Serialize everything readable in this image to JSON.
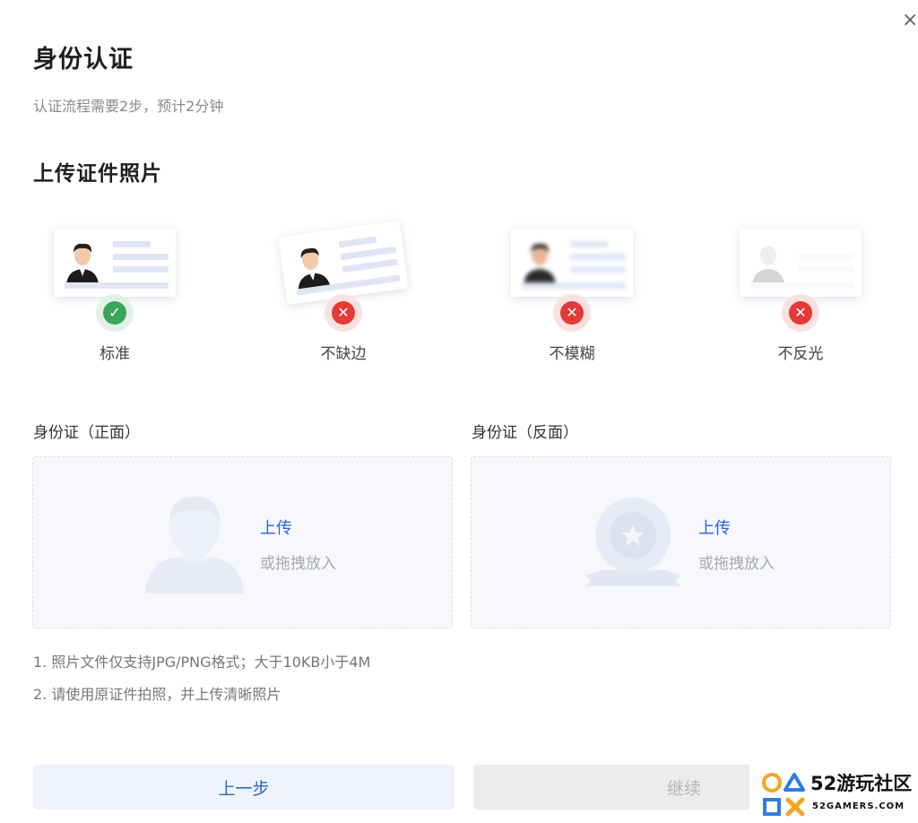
{
  "dialog": {
    "title": "身份认证",
    "subtitle": "认证流程需要2步，预计2分钟",
    "close_icon": "×"
  },
  "photo_section": {
    "title": "上传证件照片",
    "examples": [
      {
        "label": "标准",
        "status": "ok",
        "icon": "check-icon",
        "glyph": "✓"
      },
      {
        "label": "不缺边",
        "status": "bad",
        "icon": "x-icon",
        "glyph": "✕"
      },
      {
        "label": "不模糊",
        "status": "bad",
        "icon": "x-icon",
        "glyph": "✕"
      },
      {
        "label": "不反光",
        "status": "bad",
        "icon": "x-icon",
        "glyph": "✕"
      }
    ]
  },
  "uploads": {
    "front": {
      "label": "身份证（正面）",
      "link": "上传",
      "hint": "或拖拽放入"
    },
    "back": {
      "label": "身份证（反面）",
      "link": "上传",
      "hint": "或拖拽放入"
    }
  },
  "notes": [
    "1. 照片文件仅支持JPG/PNG格式；大于10KB小于4M",
    "2. 请使用原证件拍照，并上传清晰照片"
  ],
  "buttons": {
    "prev": "上一步",
    "next": "继续"
  },
  "watermark": {
    "brand": "52游玩社区",
    "site": "52GAMERS.COM"
  },
  "colors": {
    "accent": "#2b63d9",
    "ok": "#3aa55c",
    "error": "#e53935"
  }
}
